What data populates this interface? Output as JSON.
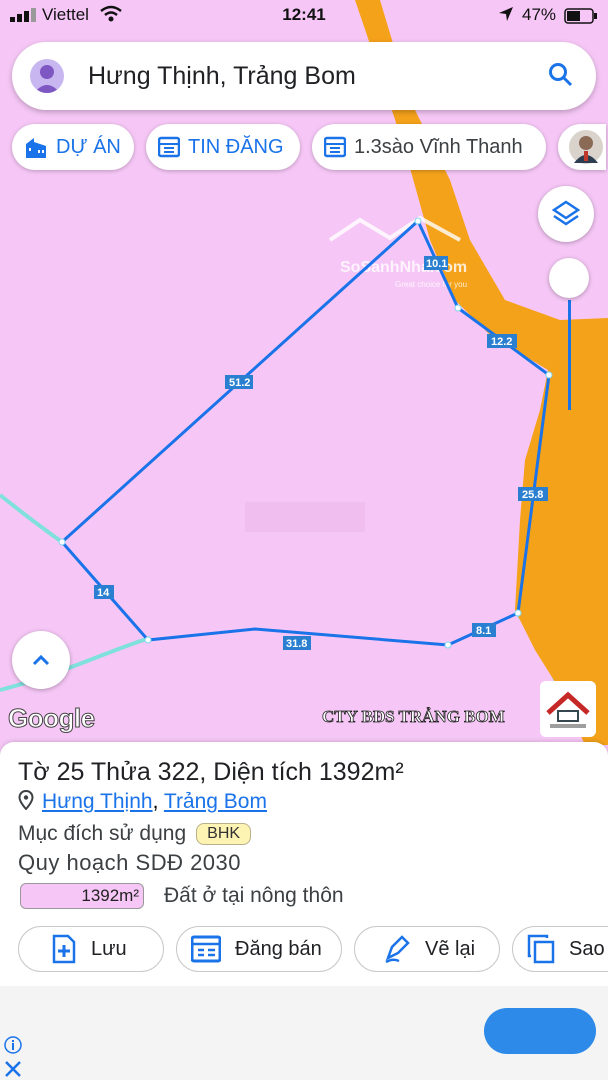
{
  "status_bar": {
    "carrier": "Viettel",
    "time": "12:41",
    "battery": "47%"
  },
  "search": {
    "query": "Hưng Thịnh, Trảng Bom"
  },
  "chips": [
    {
      "label": "DỰ ÁN",
      "icon": "building-icon"
    },
    {
      "label": "TIN ĐĂNG",
      "icon": "listing-icon"
    },
    {
      "label": "1.3sào Vĩnh Thanh",
      "icon": "listing-icon"
    }
  ],
  "map": {
    "edge_labels": [
      "10.1",
      "12.2",
      "51.2",
      "25.8",
      "14",
      "31.8",
      "8.1"
    ],
    "watermark_text": "SoSanhNha.com",
    "watermark_sub": "Great choice for you",
    "google_logo": "Google",
    "company_watermark": "CTY BĐS TRẢNG BOM",
    "colors": {
      "land": "#f6c7f6",
      "road": "#f5a21b",
      "boundary": "#1a73e8",
      "edge": "#7fe0dc"
    }
  },
  "panel": {
    "title": "Tờ 25 Thửa 322, Diện tích 1392m²",
    "location_commune": "Hưng Thịnh",
    "location_separator": ",",
    "location_district": "Trảng Bom",
    "purpose_label": "Mục đích sử dụng",
    "purpose_code": "BHK",
    "plan_label": "Quy hoạch SDĐ 2030",
    "area_value": "1392m²",
    "land_type": "Đất ở tại nông thôn",
    "buttons": {
      "save": "Lưu",
      "sell": "Đăng bán",
      "redraw": "Vẽ lại",
      "copy": "Sao"
    }
  }
}
